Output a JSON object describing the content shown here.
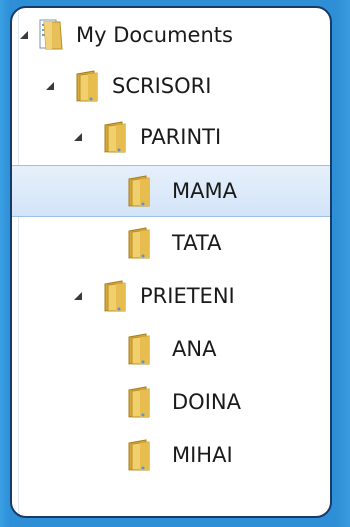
{
  "tree": {
    "items": [
      {
        "label": "My Documents",
        "level": 0,
        "expanded": true,
        "icon": "documents-folder-icon",
        "selected": false
      },
      {
        "label": "SCRISORI",
        "level": 1,
        "expanded": true,
        "icon": "folder-icon",
        "selected": false
      },
      {
        "label": "PARINTI",
        "level": 2,
        "expanded": true,
        "icon": "folder-icon",
        "selected": false
      },
      {
        "label": "MAMA",
        "level": 3,
        "expanded": null,
        "icon": "folder-icon",
        "selected": true
      },
      {
        "label": "TATA",
        "level": 3,
        "expanded": null,
        "icon": "folder-icon",
        "selected": false
      },
      {
        "label": "PRIETENI",
        "level": 2,
        "expanded": true,
        "icon": "folder-icon",
        "selected": false
      },
      {
        "label": "ANA",
        "level": 3,
        "expanded": null,
        "icon": "folder-icon",
        "selected": false
      },
      {
        "label": "DOINA",
        "level": 3,
        "expanded": null,
        "icon": "folder-icon",
        "selected": false
      },
      {
        "label": "MIHAI",
        "level": 3,
        "expanded": null,
        "icon": "folder-icon",
        "selected": false
      }
    ]
  },
  "colors": {
    "background": "#2f8fd6",
    "panel_border": "#173a68",
    "selection": "#d3e4f8",
    "folder": "#e8c05a"
  }
}
